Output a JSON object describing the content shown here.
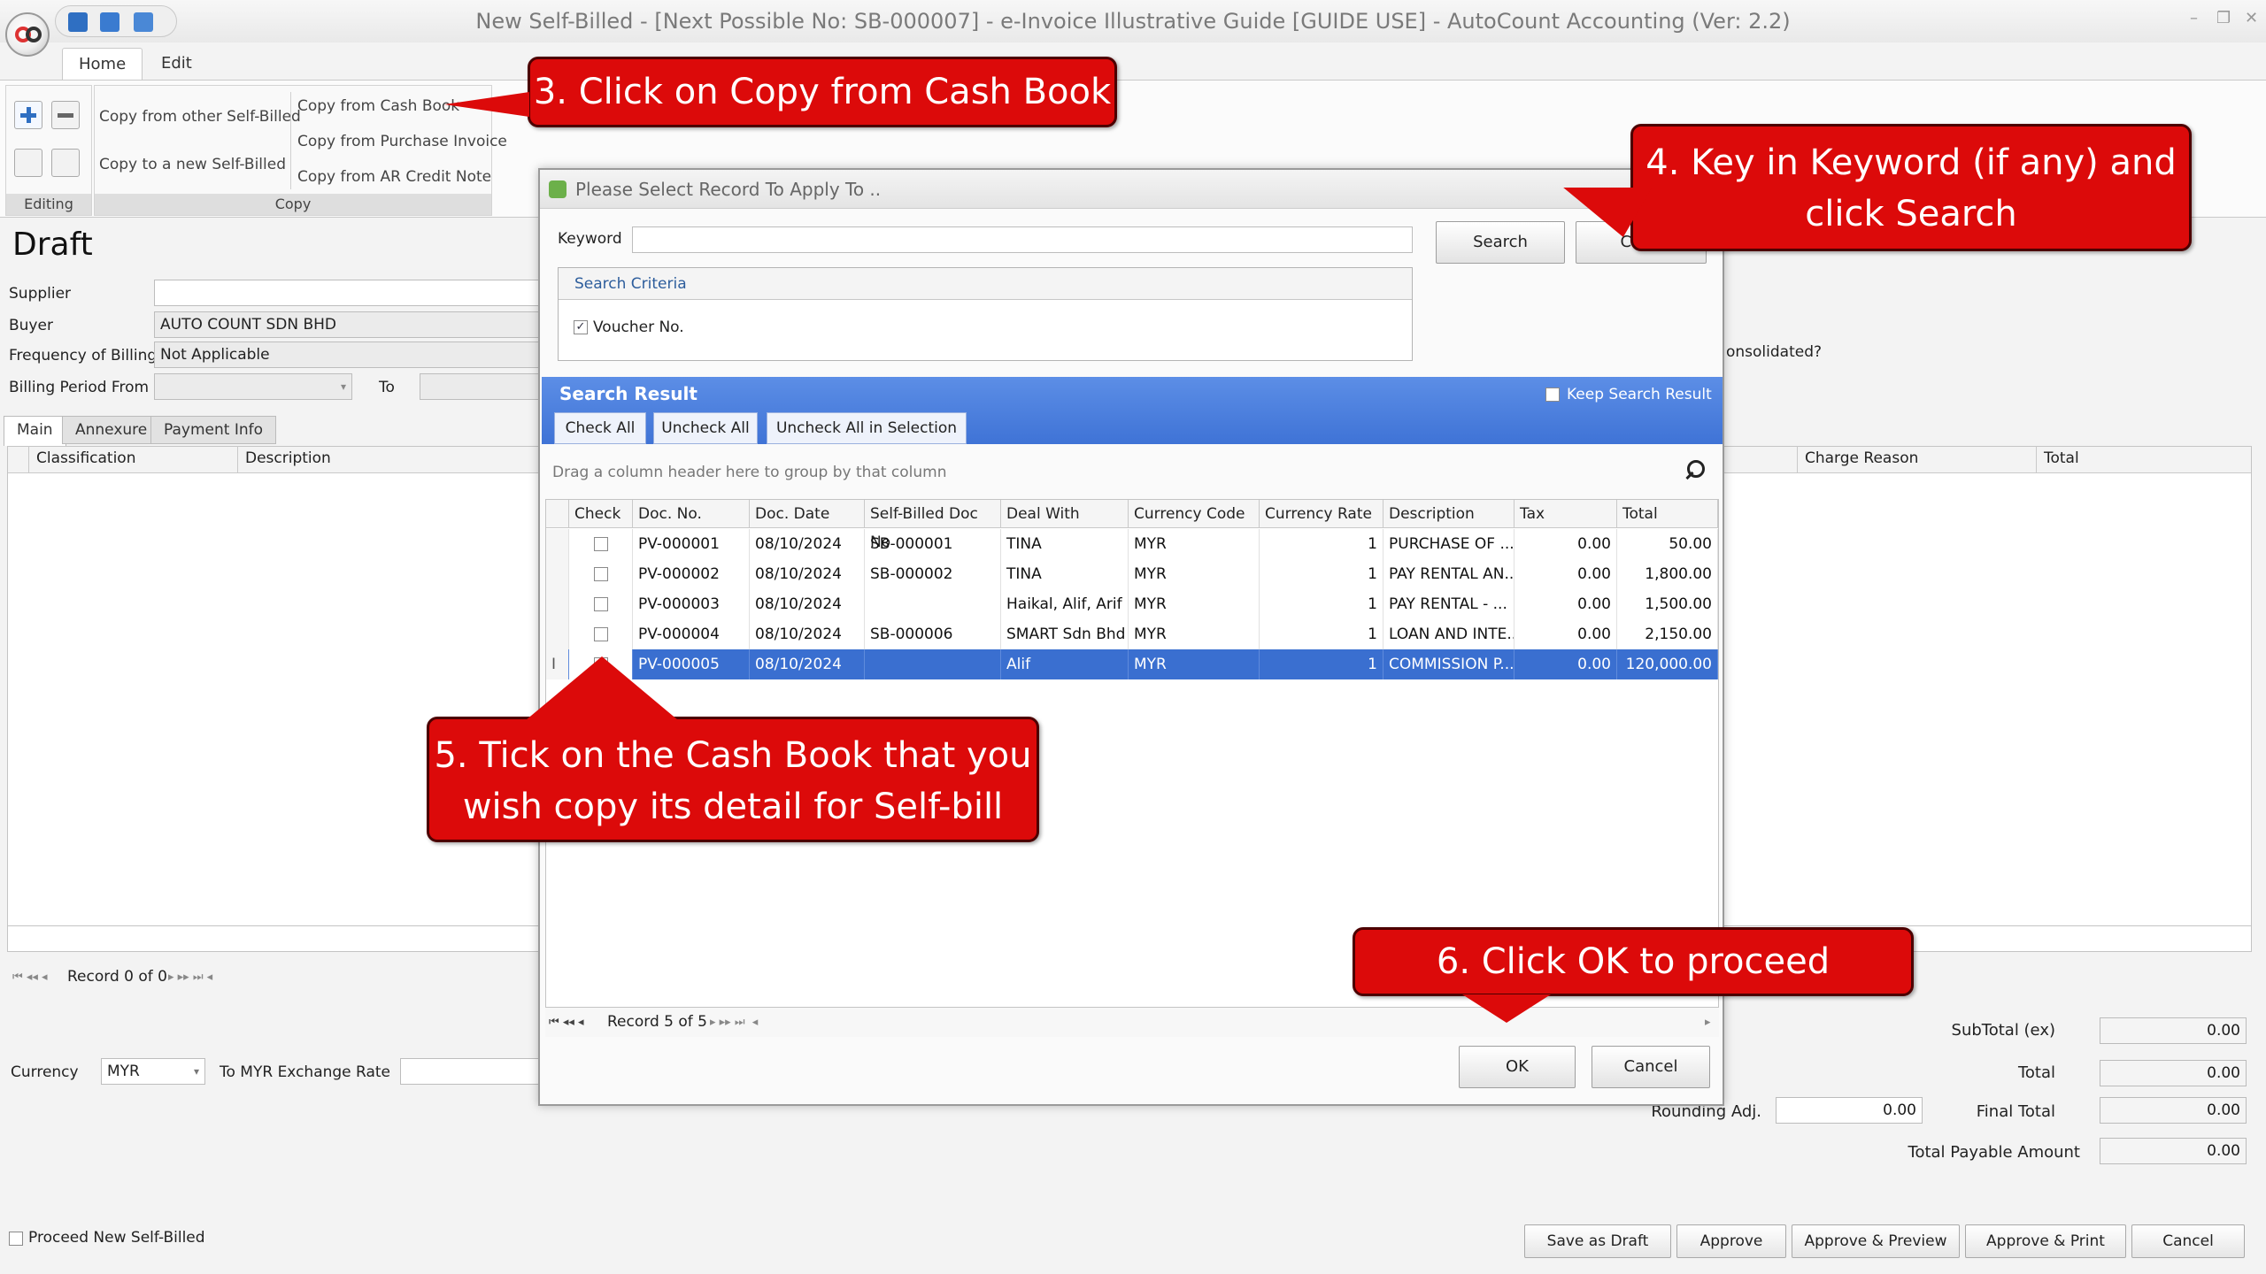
{
  "window": {
    "title": "New Self-Billed - [Next Possible No: SB-000007] - e-Invoice Illustrative Guide [GUIDE USE] - AutoCount Accounting (Ver: 2.2)",
    "controls": [
      "–",
      "❐",
      "✕"
    ]
  },
  "ribbon": {
    "tabs": [
      "Home",
      "Edit"
    ],
    "groups": {
      "editing": "Editing",
      "copy": "Copy"
    },
    "buttons": {
      "copy_from_other": "Copy from other Self-Billed",
      "copy_to_new": "Copy to a new Self-Billed",
      "copy_from_cash_book": "Copy from Cash Book",
      "copy_from_purchase_invoice": "Copy from Purchase Invoice",
      "copy_from_ar_credit_note": "Copy from AR Credit Note"
    }
  },
  "form": {
    "status": "Draft",
    "supplier_label": "Supplier",
    "supplier_value": "",
    "buyer_label": "Buyer",
    "buyer_value": "AUTO COUNT SDN BHD",
    "frequency_label": "Frequency of Billing",
    "frequency_value": "Not Applicable",
    "billing_from_label": "Billing Period From",
    "billing_to_label": "To",
    "consolidated_label": "onsolidated?",
    "tabs": [
      "Main",
      "Annexure",
      "Payment Info"
    ],
    "grid_headers": [
      "Classification",
      "Description",
      "Charge Reason",
      "Total"
    ],
    "record_text": "Record 0 of 0",
    "currency_label": "Currency",
    "currency_value": "MYR",
    "exchange_label": "To MYR Exchange Rate",
    "proceed_label": "Proceed New Self-Billed"
  },
  "summary": {
    "subtotal_label": "SubTotal (ex)",
    "subtotal_value": "0.00",
    "total_label": "Total",
    "total_value": "0.00",
    "rounding_label": "Rounding Adj.",
    "rounding_value": "0.00",
    "final_label": "Final Total",
    "final_value": "0.00",
    "payable_label": "Total Payable Amount",
    "payable_value": "0.00"
  },
  "bottom_buttons": [
    "Save as Draft",
    "Approve",
    "Approve & Preview",
    "Approve & Print",
    "Cancel"
  ],
  "dialog": {
    "title": "Please Select Record To Apply To ..",
    "keyword_label": "Keyword",
    "keyword_value": "",
    "search_button": "Search",
    "clear_button": "Clear",
    "criteria_title": "Search Criteria",
    "criteria_voucher": "Voucher No.",
    "result_title": "Search Result",
    "keep_result": "Keep Search Result",
    "check_all": "Check All",
    "uncheck_all": "Uncheck All",
    "uncheck_sel": "Uncheck All in Selection",
    "group_hint": "Drag a column header here to group by that column",
    "columns": [
      "Check",
      "Doc. No.",
      "Doc. Date",
      "Self-Billed Doc No",
      "Deal With",
      "Currency Code",
      "Currency Rate",
      "Description",
      "Tax",
      "Total"
    ],
    "rows": [
      {
        "doc": "PV-000001",
        "date": "08/10/2024",
        "sb": "SB-000001",
        "deal": "TINA",
        "cur": "MYR",
        "rate": "1",
        "desc": "PURCHASE OF ...",
        "tax": "0.00",
        "total": "50.00"
      },
      {
        "doc": "PV-000002",
        "date": "08/10/2024",
        "sb": "SB-000002",
        "deal": "TINA",
        "cur": "MYR",
        "rate": "1",
        "desc": "PAY RENTAL AN...",
        "tax": "0.00",
        "total": "1,800.00"
      },
      {
        "doc": "PV-000003",
        "date": "08/10/2024",
        "sb": "",
        "deal": "Haikal, Alif, Arif",
        "cur": "MYR",
        "rate": "1",
        "desc": "PAY RENTAL - ...",
        "tax": "0.00",
        "total": "1,500.00"
      },
      {
        "doc": "PV-000004",
        "date": "08/10/2024",
        "sb": "SB-000006",
        "deal": "SMART Sdn Bhd",
        "cur": "MYR",
        "rate": "1",
        "desc": "LOAN AND INTE...",
        "tax": "0.00",
        "total": "2,150.00"
      },
      {
        "doc": "PV-000005",
        "date": "08/10/2024",
        "sb": "",
        "deal": "Alif",
        "cur": "MYR",
        "rate": "1",
        "desc": "COMMISSION P...",
        "tax": "0.00",
        "total": "120,000.00"
      }
    ],
    "record_text": "Record 5 of 5",
    "ok_button": "OK",
    "cancel_button": "Cancel"
  },
  "callouts": {
    "step3": "3. Click on Copy from Cash Book",
    "step4_line1": "4. Key in Keyword (if any) and",
    "step4_line2": "click Search",
    "step5_line1": "5. Tick on the Cash Book that you",
    "step5_line2": "wish copy its detail for Self-bill",
    "step6": "6. Click OK to proceed"
  },
  "colors": {
    "callout_red": "#dc0a0a",
    "selection_blue": "#3a6fd0",
    "result_bar_blue": "#4a7fe0"
  }
}
